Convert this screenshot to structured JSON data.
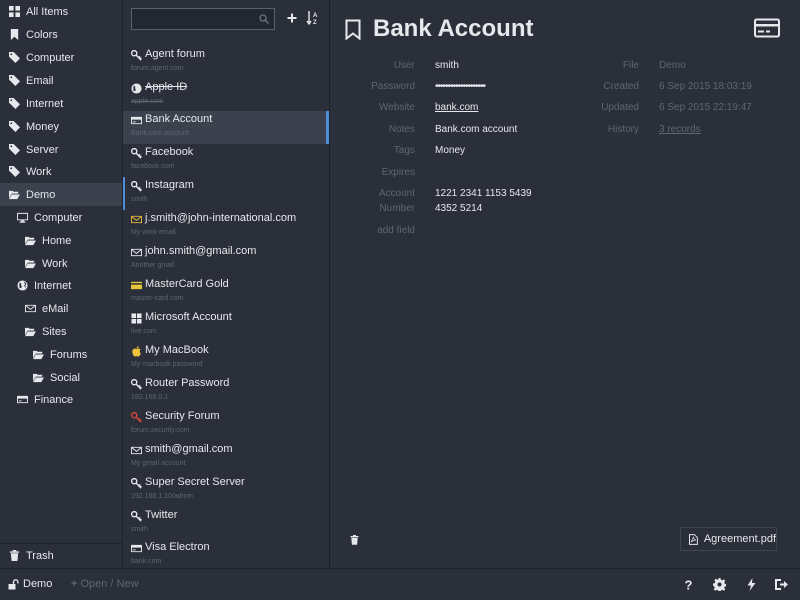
{
  "menu": {
    "items": [
      {
        "label": "All Items",
        "icon": "grid-icon"
      },
      {
        "label": "Colors",
        "icon": "bookmark-icon"
      },
      {
        "label": "Computer",
        "icon": "tag-icon"
      },
      {
        "label": "Email",
        "icon": "tag-icon"
      },
      {
        "label": "Internet",
        "icon": "tag-icon"
      },
      {
        "label": "Money",
        "icon": "tag-icon"
      },
      {
        "label": "Server",
        "icon": "tag-icon"
      },
      {
        "label": "Work",
        "icon": "tag-icon"
      },
      {
        "label": "Demo",
        "icon": "folder-open-icon"
      },
      {
        "label": "Computer",
        "icon": "desktop-icon"
      },
      {
        "label": "Home",
        "icon": "folder-open-icon"
      },
      {
        "label": "Work",
        "icon": "folder-open-icon"
      },
      {
        "label": "Internet",
        "icon": "globe-icon"
      },
      {
        "label": "eMail",
        "icon": "envelope-icon"
      },
      {
        "label": "Sites",
        "icon": "folder-open-icon"
      },
      {
        "label": "Forums",
        "icon": "folder-open-icon"
      },
      {
        "label": "Social",
        "icon": "folder-open-icon"
      },
      {
        "label": "Finance",
        "icon": "credit-card-icon"
      }
    ],
    "trash": "Trash"
  },
  "search": {
    "value": "",
    "placeholder": ""
  },
  "entries": [
    {
      "title": "Agent forum",
      "sub": "forum.agent.com",
      "icon": "key-icon"
    },
    {
      "title": "Apple ID",
      "sub": "apple.com",
      "icon": "globe-icon"
    },
    {
      "title": "Bank Account",
      "sub": "Bank.com account",
      "icon": "credit-card-icon"
    },
    {
      "title": "Facebook",
      "sub": "facebook.com",
      "icon": "key-icon"
    },
    {
      "title": "Instagram",
      "sub": "smith",
      "icon": "key-icon"
    },
    {
      "title": "j.smith@john-international.com",
      "sub": "My work email",
      "icon": "envelope-icon"
    },
    {
      "title": "john.smith@gmail.com",
      "sub": "Another gmail",
      "icon": "envelope-icon"
    },
    {
      "title": "MasterCard Gold",
      "sub": "master-card.com",
      "icon": "credit-card-icon"
    },
    {
      "title": "Microsoft Account",
      "sub": "live.com",
      "icon": "windows-icon"
    },
    {
      "title": "My MacBook",
      "sub": "My macbook password",
      "icon": "apple-icon"
    },
    {
      "title": "Router Password",
      "sub": "192.168.0.1",
      "icon": "key-icon"
    },
    {
      "title": "Security Forum",
      "sub": "forum.security.com",
      "icon": "key-icon"
    },
    {
      "title": "smith@gmail.com",
      "sub": "My gmail account",
      "icon": "envelope-icon"
    },
    {
      "title": "Super Secret Server",
      "sub": "192.168.1.10/admin",
      "icon": "key-icon"
    },
    {
      "title": "Twitter",
      "sub": "smith",
      "icon": "key-icon"
    },
    {
      "title": "Visa Electron",
      "sub": "bank.com",
      "icon": "credit-card-icon"
    }
  ],
  "details": {
    "title": "Bank Account",
    "fields": [
      {
        "label": "User",
        "value": "smith"
      },
      {
        "label": "Password",
        "value": "••••••••••••••••••••"
      },
      {
        "label": "Website",
        "value": "bank.com"
      },
      {
        "label": "Notes",
        "value": "Bank.com account"
      },
      {
        "label": "Tags",
        "value": "Money"
      },
      {
        "label": "Expires",
        "value": ""
      },
      {
        "label": "Account",
        "label2": "Number",
        "value": "1221 2341 1153 5439",
        "value2": "4352 5214"
      }
    ],
    "add_field": "add field",
    "meta": [
      {
        "label": "File",
        "value": "Demo"
      },
      {
        "label": "Created",
        "value": "6 Sep 2015 18:03:19"
      },
      {
        "label": "Updated",
        "value": "6 Sep 2015 22:19:47"
      },
      {
        "label": "History",
        "value": "3 records"
      }
    ],
    "attachment": "Agreement.pdf"
  },
  "footer": {
    "file": "Demo",
    "open_new": "Open / New"
  },
  "colors": {
    "background": "#2a2f3a",
    "selected": "#3b414d",
    "accent": "#4f8ed8",
    "muted": "#5f6571",
    "email_yellow": "#e8b73a",
    "mastercard_yellow": "#e8c53a",
    "apple_yellow": "#f0c43a",
    "security_red": "#d0453b"
  }
}
